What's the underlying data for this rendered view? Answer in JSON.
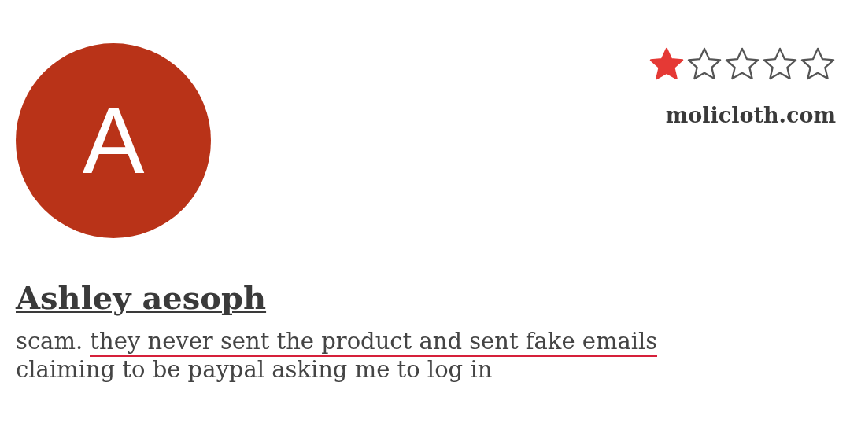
{
  "review": {
    "avatar_letter": "A",
    "stars": 1,
    "site": "molicloth.com",
    "author": "Ashley aesoph",
    "text_parts": [
      {
        "text": "scam. ",
        "underlined": false
      },
      {
        "text": "they never sent the product and sent fake emails",
        "underlined": true
      },
      {
        "text": " claiming to be paypal asking me to log in",
        "underlined": false
      }
    ]
  }
}
